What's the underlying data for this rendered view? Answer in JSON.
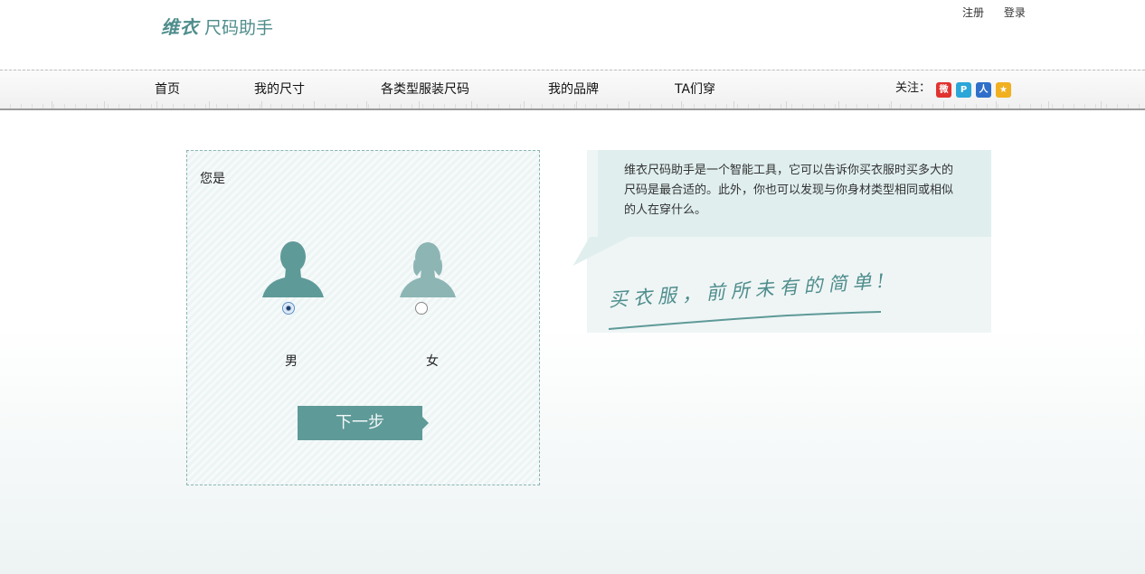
{
  "header": {
    "logo_script": "维衣",
    "logo_text": "尺码助手",
    "links": {
      "register": "注册",
      "login": "登录"
    }
  },
  "nav": {
    "items": [
      "首页",
      "我的尺寸",
      "各类型服装尺码",
      "我的品牌",
      "TA们穿"
    ],
    "follow_label": "关注：",
    "social": [
      {
        "name": "weibo-icon",
        "glyph": "微",
        "color": "#e0332f"
      },
      {
        "name": "tencent-weibo-icon",
        "glyph": "P",
        "color": "#2aa6d8"
      },
      {
        "name": "renren-icon",
        "glyph": "人",
        "color": "#2f6fc9"
      },
      {
        "name": "qzone-icon",
        "glyph": "★",
        "color": "#f0b020"
      }
    ]
  },
  "gender_panel": {
    "question": "您是",
    "male_label": "男",
    "female_label": "女",
    "selected": "male",
    "next_button": "下一步"
  },
  "intro": {
    "text": "维衣尺码助手是一个智能工具，它可以告诉你买衣服时买多大的尺码是最合适的。此外，你也可以发现与你身材类型相同或相似的人在穿什么。",
    "slogan": "买衣服，前所未有的简单!"
  },
  "colors": {
    "accent": "#4e8d8c",
    "button": "#5e9a98",
    "female_avatar": "#8cb5b4"
  }
}
